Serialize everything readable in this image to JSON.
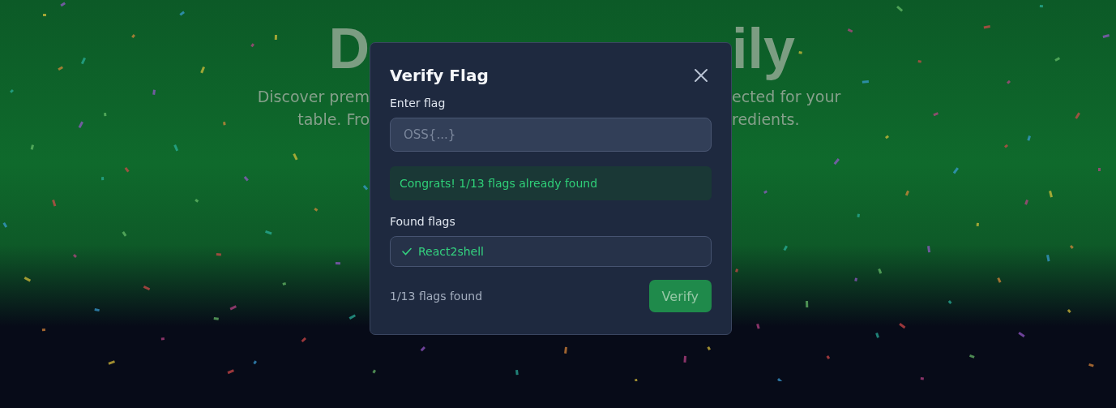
{
  "hero": {
    "title_parts": {
      "left": "D",
      "right": "ily"
    },
    "description_lines": [
      {
        "left": "Discover prem",
        "right": "ected for your"
      },
      {
        "left": "table. Fro",
        "right": "redients."
      }
    ]
  },
  "dialog": {
    "title": "Verify Flag",
    "flag_field": {
      "label": "Enter flag",
      "placeholder": "OSS{...}"
    },
    "alert": {
      "message": "Congrats! 1/13 flags already found"
    },
    "found_flags": {
      "label": "Found flags",
      "items": [
        {
          "name": "React2shell",
          "found": true
        }
      ]
    },
    "footer": {
      "count": "1/13 flags found",
      "verify_button": {
        "label": "Verify",
        "disabled": true
      }
    }
  }
}
